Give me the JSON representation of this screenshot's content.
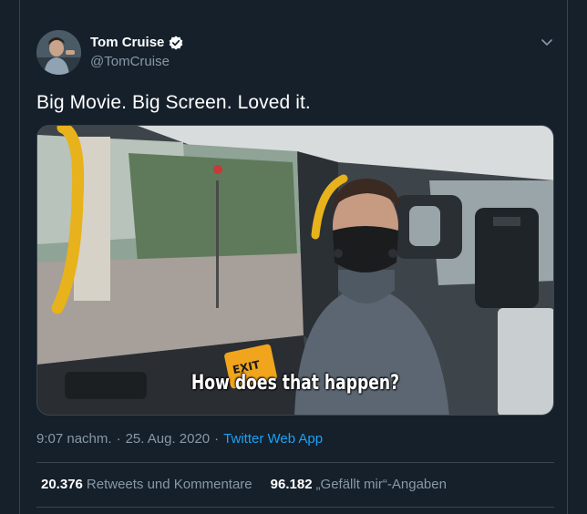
{
  "tweet": {
    "display_name": "Tom Cruise",
    "handle": "@TomCruise",
    "text": "Big Movie. Big Screen. Loved it.",
    "media": {
      "subtitle": "How does that happen?",
      "exit_sign": "EXIT"
    },
    "time": "9:07 nachm.",
    "separator": "·",
    "date": "25. Aug. 2020",
    "source": "Twitter Web App",
    "stats": {
      "retweets_count": "20.376",
      "retweets_label": "Retweets und Kommentare",
      "likes_count": "96.182",
      "likes_label": "„Gefällt mir“-Angaben"
    }
  },
  "icons": {
    "verified": "verified-badge-icon",
    "more": "chevron-down-icon"
  },
  "colors": {
    "background": "#15202b",
    "accent": "#1da1f2",
    "secondary_text": "#8899a6",
    "border": "#38444d"
  }
}
